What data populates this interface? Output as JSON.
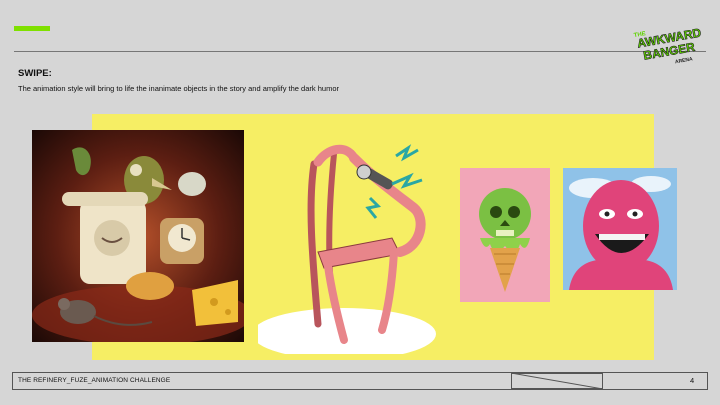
{
  "slide": {
    "heading": "SWIPE:",
    "subtitle": "The animation style will bring to life the inanimate objects in the story and amplify the dark humor",
    "footer_title": "THE REFINERY_FUZE_ANIMATION CHALLENGE",
    "page_number": "4"
  },
  "logo": {
    "line1": "THE",
    "line2": "AWKWARD",
    "line3": "BANGER",
    "line4": "ARENA",
    "colors": {
      "green": "#5fd400",
      "dark": "#1d1d1d"
    }
  },
  "colors": {
    "background": "#d6d6d6",
    "accent": "#7fe000",
    "panel_yellow": "#f6ee64",
    "chair_pink": "#e8858a",
    "skull_green": "#7bc043",
    "face_pink": "#e0447a"
  },
  "images": [
    {
      "name": "still-life-painting",
      "subject": "phone, bird, clock, cheese and mouse still life"
    },
    {
      "name": "chair-with-microphone",
      "subject": "pink chair holding a microphone"
    },
    {
      "name": "skull-ice-cream",
      "subject": "green skull ice cream cone"
    },
    {
      "name": "laughing-face",
      "subject": "laughing pink face"
    }
  ]
}
